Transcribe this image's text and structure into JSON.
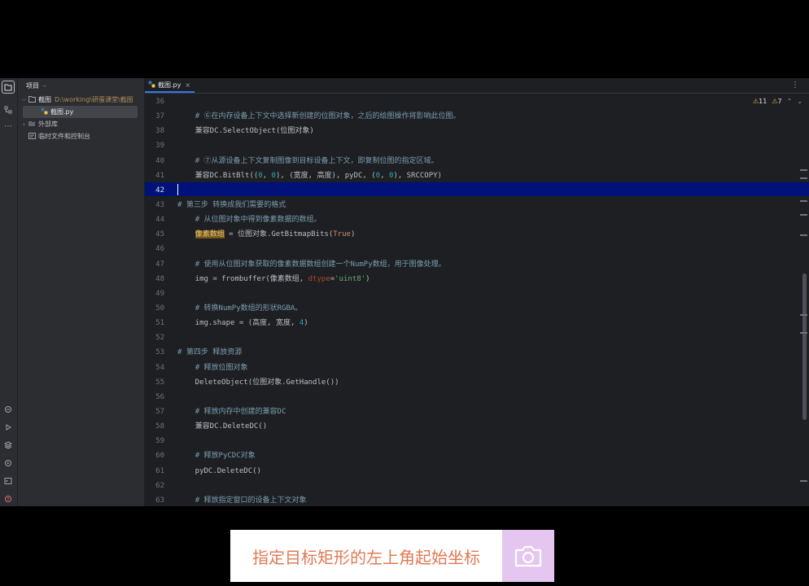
{
  "project_panel": {
    "title": "项目",
    "root_name": "截图",
    "root_path": "D:\\working\\研蛋课堂\\截图",
    "file": "截图.py",
    "external_libs": "外部库",
    "scratches": "临时文件和控制台"
  },
  "editor": {
    "tab_label": "截图.py",
    "warnings": "11",
    "weak_warnings": "7",
    "current_line": "42"
  },
  "lines": [
    {
      "n": "36",
      "t": ""
    },
    {
      "n": "37",
      "t": "    # ⑥在内存设备上下文中选择新创建的位图对象，之后的绘图操作将影响此位图。"
    },
    {
      "n": "38",
      "t": "    兼容DC.SelectObject(位图对象)"
    },
    {
      "n": "39",
      "t": ""
    },
    {
      "n": "40",
      "t": "    # ⑦从源设备上下文复制图像到目标设备上下文，即复制位图的指定区域。"
    },
    {
      "n": "41",
      "t": "    兼容DC.BitBlt((0, 0), (宽度, 高度), pyDC, (0, 0), SRCCOPY)"
    },
    {
      "n": "42",
      "t": ""
    },
    {
      "n": "43",
      "t": "# 第三步 转换成我们需要的格式"
    },
    {
      "n": "44",
      "t": "    # 从位图对象中得到像素数据的数组。"
    },
    {
      "n": "45",
      "t": "    像素数组 = 位图对象.GetBitmapBits(True)"
    },
    {
      "n": "46",
      "t": ""
    },
    {
      "n": "47",
      "t": "    # 使用从位图对象获取的像素数据数组创建一个NumPy数组，用于图像处理。"
    },
    {
      "n": "48",
      "t": "    img = frombuffer(像素数组, dtype='uint8')"
    },
    {
      "n": "49",
      "t": ""
    },
    {
      "n": "50",
      "t": "    # 转换NumPy数组的形状RGBA。"
    },
    {
      "n": "51",
      "t": "    img.shape = (高度, 宽度, 4)"
    },
    {
      "n": "52",
      "t": ""
    },
    {
      "n": "53",
      "t": "# 第四步 释放资源"
    },
    {
      "n": "54",
      "t": "    # 释放位图对象"
    },
    {
      "n": "55",
      "t": "    DeleteObject(位图对象.GetHandle())"
    },
    {
      "n": "56",
      "t": ""
    },
    {
      "n": "57",
      "t": "    # 释放内存中创建的兼容DC"
    },
    {
      "n": "58",
      "t": "    兼容DC.DeleteDC()"
    },
    {
      "n": "59",
      "t": ""
    },
    {
      "n": "60",
      "t": "    # 释放PyCDC对象"
    },
    {
      "n": "61",
      "t": "    pyDC.DeleteDC()"
    },
    {
      "n": "62",
      "t": ""
    },
    {
      "n": "63",
      "t": "    # 释放指定窗口的设备上下文对象"
    }
  ],
  "caption": "指定目标矩形的左上角起始坐标",
  "colors": {
    "editor_bg": "#1e1f22",
    "panel_bg": "#2b2d30",
    "current_line": "#00127a",
    "comment": "#7a9eb0",
    "number": "#2aacb8",
    "keyword": "#cf8e6d",
    "string": "#6aab73",
    "caption_text": "#e07a55",
    "camera_bg": "#e4c6f0"
  },
  "icons": [
    "folder-icon",
    "structure-icon",
    "more-icon",
    "python-file-icon",
    "library-icon",
    "scratch-icon",
    "warning-icon",
    "camera-icon"
  ]
}
